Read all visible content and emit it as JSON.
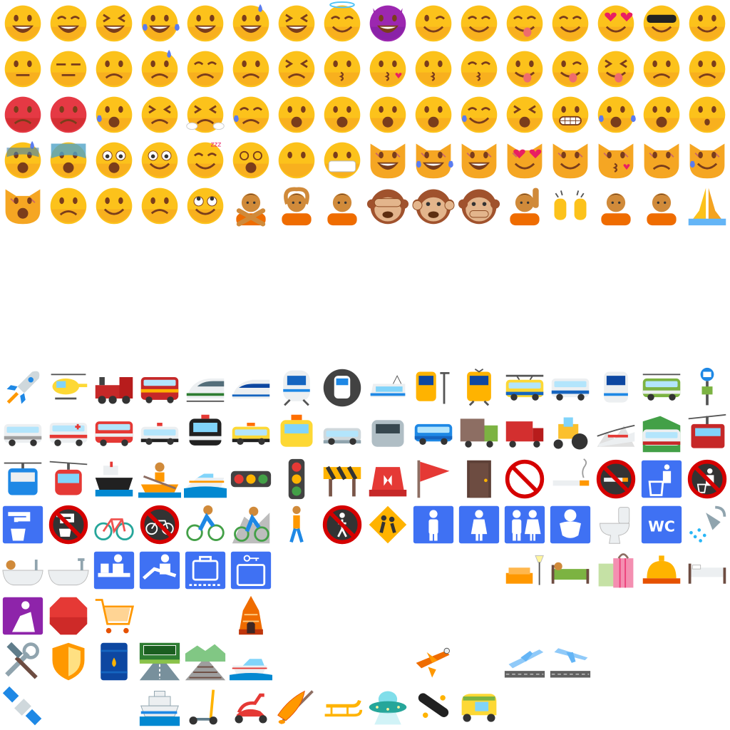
{
  "sheet": {
    "colors": {
      "background": "#ffffff",
      "face": "#fcc21b",
      "face_shadow": "#f4a321",
      "mouth": "#7a3d1b",
      "tongue": "#ef6c6c",
      "tear_blue": "#5a7cf0",
      "angry_red": "#e53944",
      "devil_purple": "#9c27b0",
      "sign_blue": "#3f71f3",
      "prohibit_red": "#d50000",
      "road_gray": "#78909c"
    },
    "smileys_rows": [
      [
        "grinning-face",
        "smiling-face-big-eyes",
        "grinning-squinting-face",
        "tears-of-joy-face",
        "grin-face",
        "grinning-sweat-face",
        "laughing-face",
        "halo-face",
        "smiling-devil-face",
        "winking-face",
        "blushing-face",
        "yum-face",
        "relieved-face",
        "heart-eyes-face",
        "sunglasses-face",
        "smirking-face"
      ],
      [
        "neutral-face",
        "expressionless-face",
        "unamused-face",
        "downcast-sweat-face",
        "pensive-face",
        "confused-face",
        "confounded-face",
        "kissing-face",
        "blowing-kiss-face",
        "kissing-smiling-eyes-face",
        "kissing-closed-eyes-face",
        "tongue-face",
        "winking-tongue-face",
        "squinting-tongue-face",
        "disappointed-face",
        "worried-face"
      ],
      [
        "pouting-face",
        "angry-face",
        "crying-face",
        "persevering-face",
        "steam-nose-face",
        "sad-relieved-face",
        "frowning-open-mouth-face",
        "anguished-face",
        "fearful-face",
        "weary-face",
        "sleepy-face",
        "tired-face",
        "grimacing-face",
        "loudly-crying-face",
        "open-mouth-face",
        "hushed-face"
      ],
      [
        "anxious-sweat-face",
        "screaming-fear-face",
        "astonished-face",
        "flushed-face",
        "sleeping-face",
        "dizzy-face",
        "no-mouth-face",
        "medical-mask-face",
        "grinning-cat",
        "joy-cat",
        "smiling-cat",
        "heart-eyes-cat",
        "smirk-cat",
        "kissing-cat",
        "pouting-cat",
        "crying-cat"
      ],
      [
        "weary-cat",
        "slightly-frowning-face",
        "slightly-smiling-face",
        "upside-down-face",
        "rolling-eyes-face",
        "person-gesturing-no",
        "person-gesturing-ok",
        "person-bowing",
        "see-no-evil-monkey",
        "hear-no-evil-monkey",
        "speak-no-evil-monkey",
        "person-raising-hand",
        "raising-hands",
        "person-frowning",
        "person-pouting",
        "folded-hands"
      ]
    ],
    "transport_rows": [
      [
        "rocket",
        "helicopter",
        "steam-locomotive",
        "railway-car",
        "high-speed-train",
        "bullet-train",
        "train",
        "metro",
        "light-rail",
        "station",
        "tram",
        "monorail",
        "mountain-railway",
        "tram-car",
        "bus",
        "bus-stop"
      ],
      [
        "minibus",
        "ambulance",
        "fire-engine",
        "police-car",
        "oncoming-police-car",
        "taxi",
        "oncoming-taxi",
        "automobile",
        "oncoming-automobile",
        "suv",
        "delivery-truck",
        "articulated-lorry",
        "tractor",
        "mountain-cableway",
        "suspension-railway",
        "aerial-tramway"
      ],
      [
        "mountain-cableway-2",
        "aerial-tramway-2",
        "ship",
        "person-rowing-boat",
        "speedboat",
        "horizontal-traffic-light",
        "vertical-traffic-light",
        "construction",
        "police-light",
        "triangular-flag",
        "door",
        "no-entry",
        "cigarette",
        "no-smoking",
        "litter-bin",
        "no-littering"
      ],
      [
        "potable-water",
        "non-potable-water",
        "bicycle",
        "no-bicycles",
        "person-biking",
        "mountain-biker",
        "person-walking",
        "no-pedestrians",
        "children-crossing",
        "mens-room",
        "womens-room",
        "restroom",
        "baby-symbol",
        "toilet",
        "water-closet",
        "shower"
      ],
      [
        "person-in-bath",
        "bathtub",
        "passport-control",
        "customs",
        "baggage-claim",
        "left-luggage",
        "",
        "",
        "",
        "",
        "",
        "couch-and-lamp",
        "person-in-bed",
        "shopping-bags",
        "bellhop-bell",
        "bed"
      ],
      [
        "place-of-worship",
        "stop-sign",
        "shopping-cart",
        "",
        "",
        "hindu-temple",
        "",
        "",
        "",
        "",
        "",
        "",
        "",
        "",
        "",
        ""
      ],
      [
        "hammer-and-wrench",
        "shield",
        "oil-drum",
        "motorway",
        "railway-track",
        "motor-boat",
        "",
        "",
        "",
        "small-airplane",
        "",
        "airplane-departure",
        "airplane-arrival",
        "",
        "",
        ""
      ],
      [
        "satellite",
        "",
        "",
        "passenger-ship",
        "kick-scooter",
        "motor-scooter",
        "canoe",
        "sled",
        "flying-saucer",
        "skateboard",
        "auto-rickshaw",
        "",
        "",
        "",
        "",
        ""
      ]
    ],
    "labels": {
      "wc": "WC"
    }
  }
}
